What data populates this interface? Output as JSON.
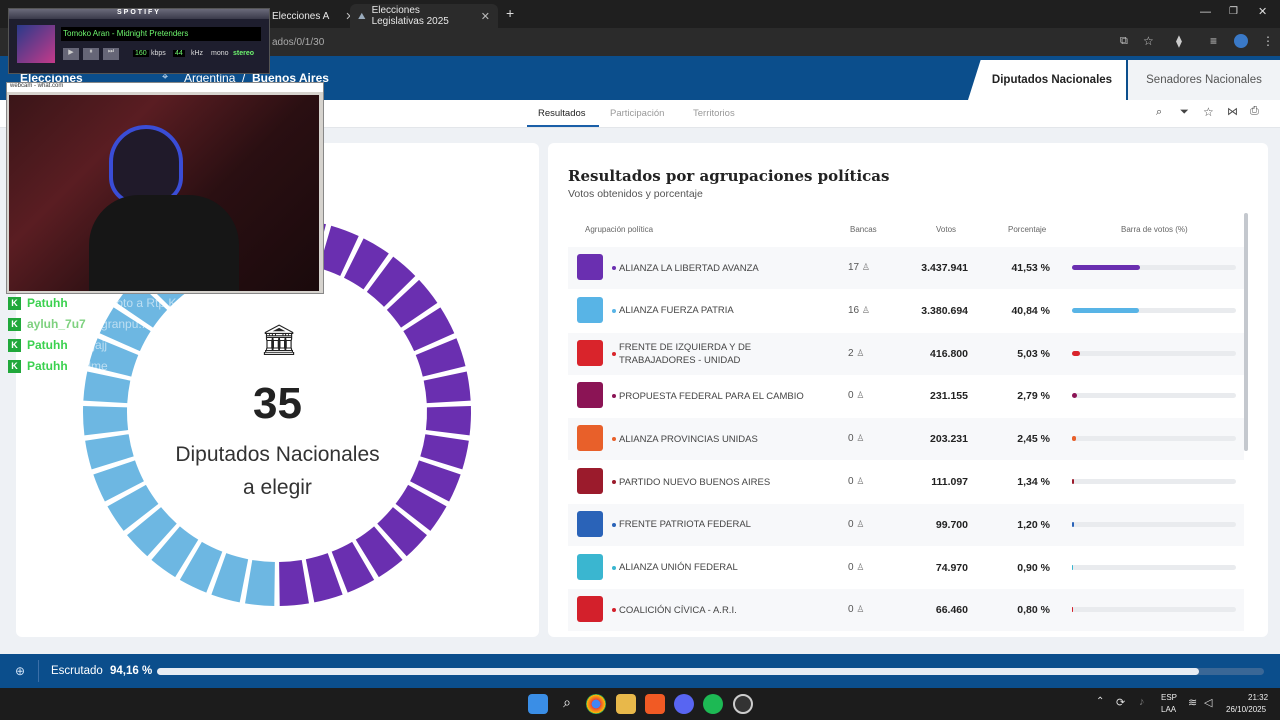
{
  "browser": {
    "tabs": [
      {
        "label": "Elecciones A"
      },
      {
        "label": "Elecciones Legislativas 2025"
      }
    ],
    "address": "ados/0/1/30"
  },
  "site": {
    "brand": "Elecciones",
    "breadcrumb_country": "Argentina",
    "breadcrumb_sep": "/",
    "breadcrumb_region": "Buenos Aires",
    "chamber_tabs": [
      {
        "label": "Diputados Nacionales"
      },
      {
        "label": "Senadores Nacionales"
      }
    ],
    "subtabs": [
      {
        "label": "Resultados"
      },
      {
        "label": "Participación"
      },
      {
        "label": "Territorios"
      }
    ]
  },
  "donut": {
    "number": "35",
    "line1": "Diputados Nacionales",
    "line2": "a elegir",
    "seats_purple": 17,
    "seats_blue": 16,
    "seats_red": 2
  },
  "results": {
    "title": "Resultados por agrupaciones políticas",
    "subtitle": "Votos obtenidos y porcentaje",
    "columns": {
      "party": "Agrupación política",
      "bancas": "Bancas",
      "votos": "Votos",
      "pct": "Porcentaje",
      "barra": "Barra de votos (%)"
    },
    "rows": [
      {
        "name": "ALIANZA LA LIBERTAD AVANZA",
        "bancas": "17",
        "votos": "3.437.941",
        "pct": "41,53 %",
        "value": 41.53,
        "color": "#6a2fb0"
      },
      {
        "name": "ALIANZA FUERZA PATRIA",
        "bancas": "16",
        "votos": "3.380.694",
        "pct": "40,84 %",
        "value": 40.84,
        "color": "#58b4e6"
      },
      {
        "name": "FRENTE DE IZQUIERDA Y DE TRABAJADORES - UNIDAD",
        "bancas": "2",
        "votos": "416.800",
        "pct": "5,03 %",
        "value": 5.03,
        "color": "#d9242b"
      },
      {
        "name": "PROPUESTA FEDERAL PARA EL CAMBIO",
        "bancas": "0",
        "votos": "231.155",
        "pct": "2,79 %",
        "value": 2.79,
        "color": "#8b1455"
      },
      {
        "name": "ALIANZA PROVINCIAS UNIDAS",
        "bancas": "0",
        "votos": "203.231",
        "pct": "2,45 %",
        "value": 2.45,
        "color": "#e8602a"
      },
      {
        "name": "PARTIDO NUEVO BUENOS AIRES",
        "bancas": "0",
        "votos": "111.097",
        "pct": "1,34 %",
        "value": 1.34,
        "color": "#9b1b2c"
      },
      {
        "name": "FRENTE PATRIOTA FEDERAL",
        "bancas": "0",
        "votos": "99.700",
        "pct": "1,20 %",
        "value": 1.2,
        "color": "#2a63b8"
      },
      {
        "name": "ALIANZA UNIÓN FEDERAL",
        "bancas": "0",
        "votos": "74.970",
        "pct": "0,90 %",
        "value": 0.9,
        "color": "#3ab6d0"
      },
      {
        "name": "COALICIÓN CÍVICA - A.R.I.",
        "bancas": "0",
        "votos": "66.460",
        "pct": "0,80 %",
        "value": 0.8,
        "color": "#d3202b"
      }
    ]
  },
  "footer": {
    "label": "Escrutado",
    "value": "94,16 %",
    "progress": 94.16
  },
  "spotify": {
    "header": "SPOTIFY",
    "track": "Tomoko Aran - Midnight Pretenders",
    "kbps": "160",
    "kbps_label": "kbps",
    "khz": "44",
    "khz_label": "kHz",
    "mono": "mono",
    "stereo": "stereo"
  },
  "webcam": {
    "title": "webcam - what.com"
  },
  "chat": [
    {
      "user": "Patuhh",
      "msg": "donde voto a Rtp Kelme?",
      "color": "#3bd14f"
    },
    {
      "user": "ayluh_7u7",
      "msg": "jagranpu..",
      "color": "#7ed17f"
    },
    {
      "user": "Patuhh",
      "msg": "jajajajj",
      "color": "#3bd14f"
    },
    {
      "user": "Patuhh",
      "msg": "Kelme",
      "color": "#3bd14f"
    }
  ],
  "systray": {
    "lang1": "ESP",
    "lang2": "LAA",
    "time": "21:32",
    "date": "26/10/2025"
  }
}
